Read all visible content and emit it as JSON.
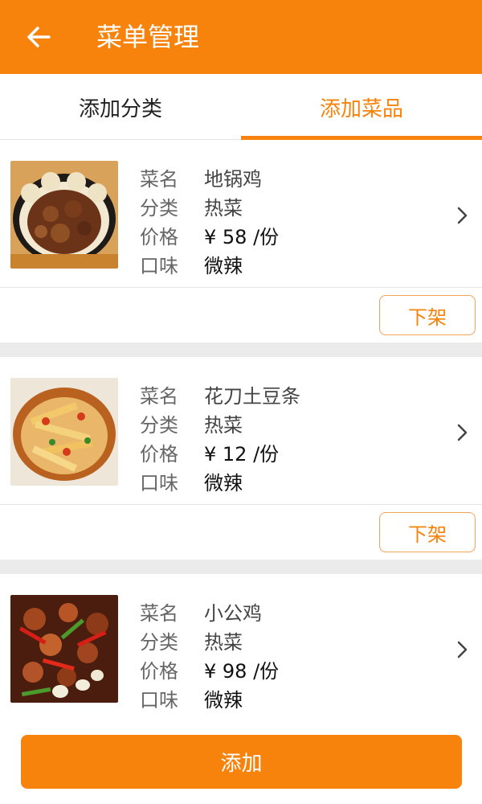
{
  "header": {
    "title": "菜单管理",
    "back_icon": "arrow-left-icon",
    "color": "#f7820c"
  },
  "tabs": [
    {
      "label": "添加分类",
      "active": false
    },
    {
      "label": "添加菜品",
      "active": true
    }
  ],
  "labels": {
    "name": "菜名",
    "category": "分类",
    "price": "价格",
    "taste": "口味"
  },
  "dishes": [
    {
      "name": "地锅鸡",
      "category": "热菜",
      "price": "¥ 58 /份",
      "taste": "微辣",
      "action": "下架"
    },
    {
      "name": "花刀土豆条",
      "category": "热菜",
      "price": "¥ 12 /份",
      "taste": "微辣",
      "action": "下架"
    },
    {
      "name": "小公鸡",
      "category": "热菜",
      "price": "¥ 98 /份",
      "taste": "微辣"
    }
  ],
  "add_button": "添加",
  "icons": {
    "chevron": "chevron-right-icon"
  }
}
